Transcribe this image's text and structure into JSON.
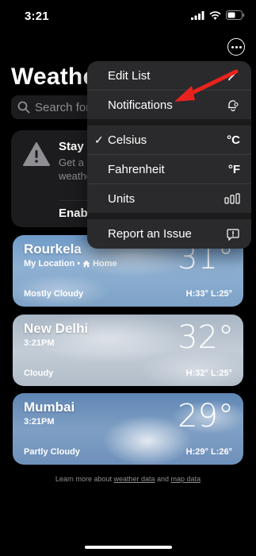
{
  "status_bar": {
    "time": "3:21"
  },
  "header": {
    "title": "Weather"
  },
  "search": {
    "placeholder": "Search for a city or airport"
  },
  "alert": {
    "title": "Stay Informed",
    "body": "Get a notification when severe weather is forecasted near you.",
    "action": "Enable Notifications"
  },
  "cities": [
    {
      "name": "Rourkela",
      "sub": "My Location • ",
      "home": "Home",
      "temp": "31°",
      "condition": "Mostly Cloudy",
      "hl": "H:33°  L:25°"
    },
    {
      "name": "New Delhi",
      "sub": "3:21PM",
      "temp": "32°",
      "condition": "Cloudy",
      "hl": "H:32°  L:25°"
    },
    {
      "name": "Mumbai",
      "sub": "3:21PM",
      "temp": "29°",
      "condition": "Partly Cloudy",
      "hl": "H:29°  L:26°"
    }
  ],
  "footer": {
    "prefix": "Learn more about ",
    "link1": "weather data",
    "mid": " and ",
    "link2": "map data"
  },
  "menu": {
    "edit_list": "Edit List",
    "notifications": "Notifications",
    "celsius": "Celsius",
    "celsius_symbol": "°C",
    "fahrenheit": "Fahrenheit",
    "fahrenheit_symbol": "°F",
    "units": "Units",
    "report": "Report an Issue",
    "check": "✓"
  },
  "icons": {
    "pencil": "pencil-icon",
    "bell": "bell-gear-icon",
    "units": "bar-chart-icon",
    "report": "report-bubble-icon",
    "search": "magnifier-icon",
    "home": "house-icon",
    "warning": "warning-triangle-icon"
  },
  "colors": {
    "annotation_arrow": "#e8231e",
    "menu_bg": "#2a2a2c",
    "card_bg": "#1c1c1e"
  }
}
